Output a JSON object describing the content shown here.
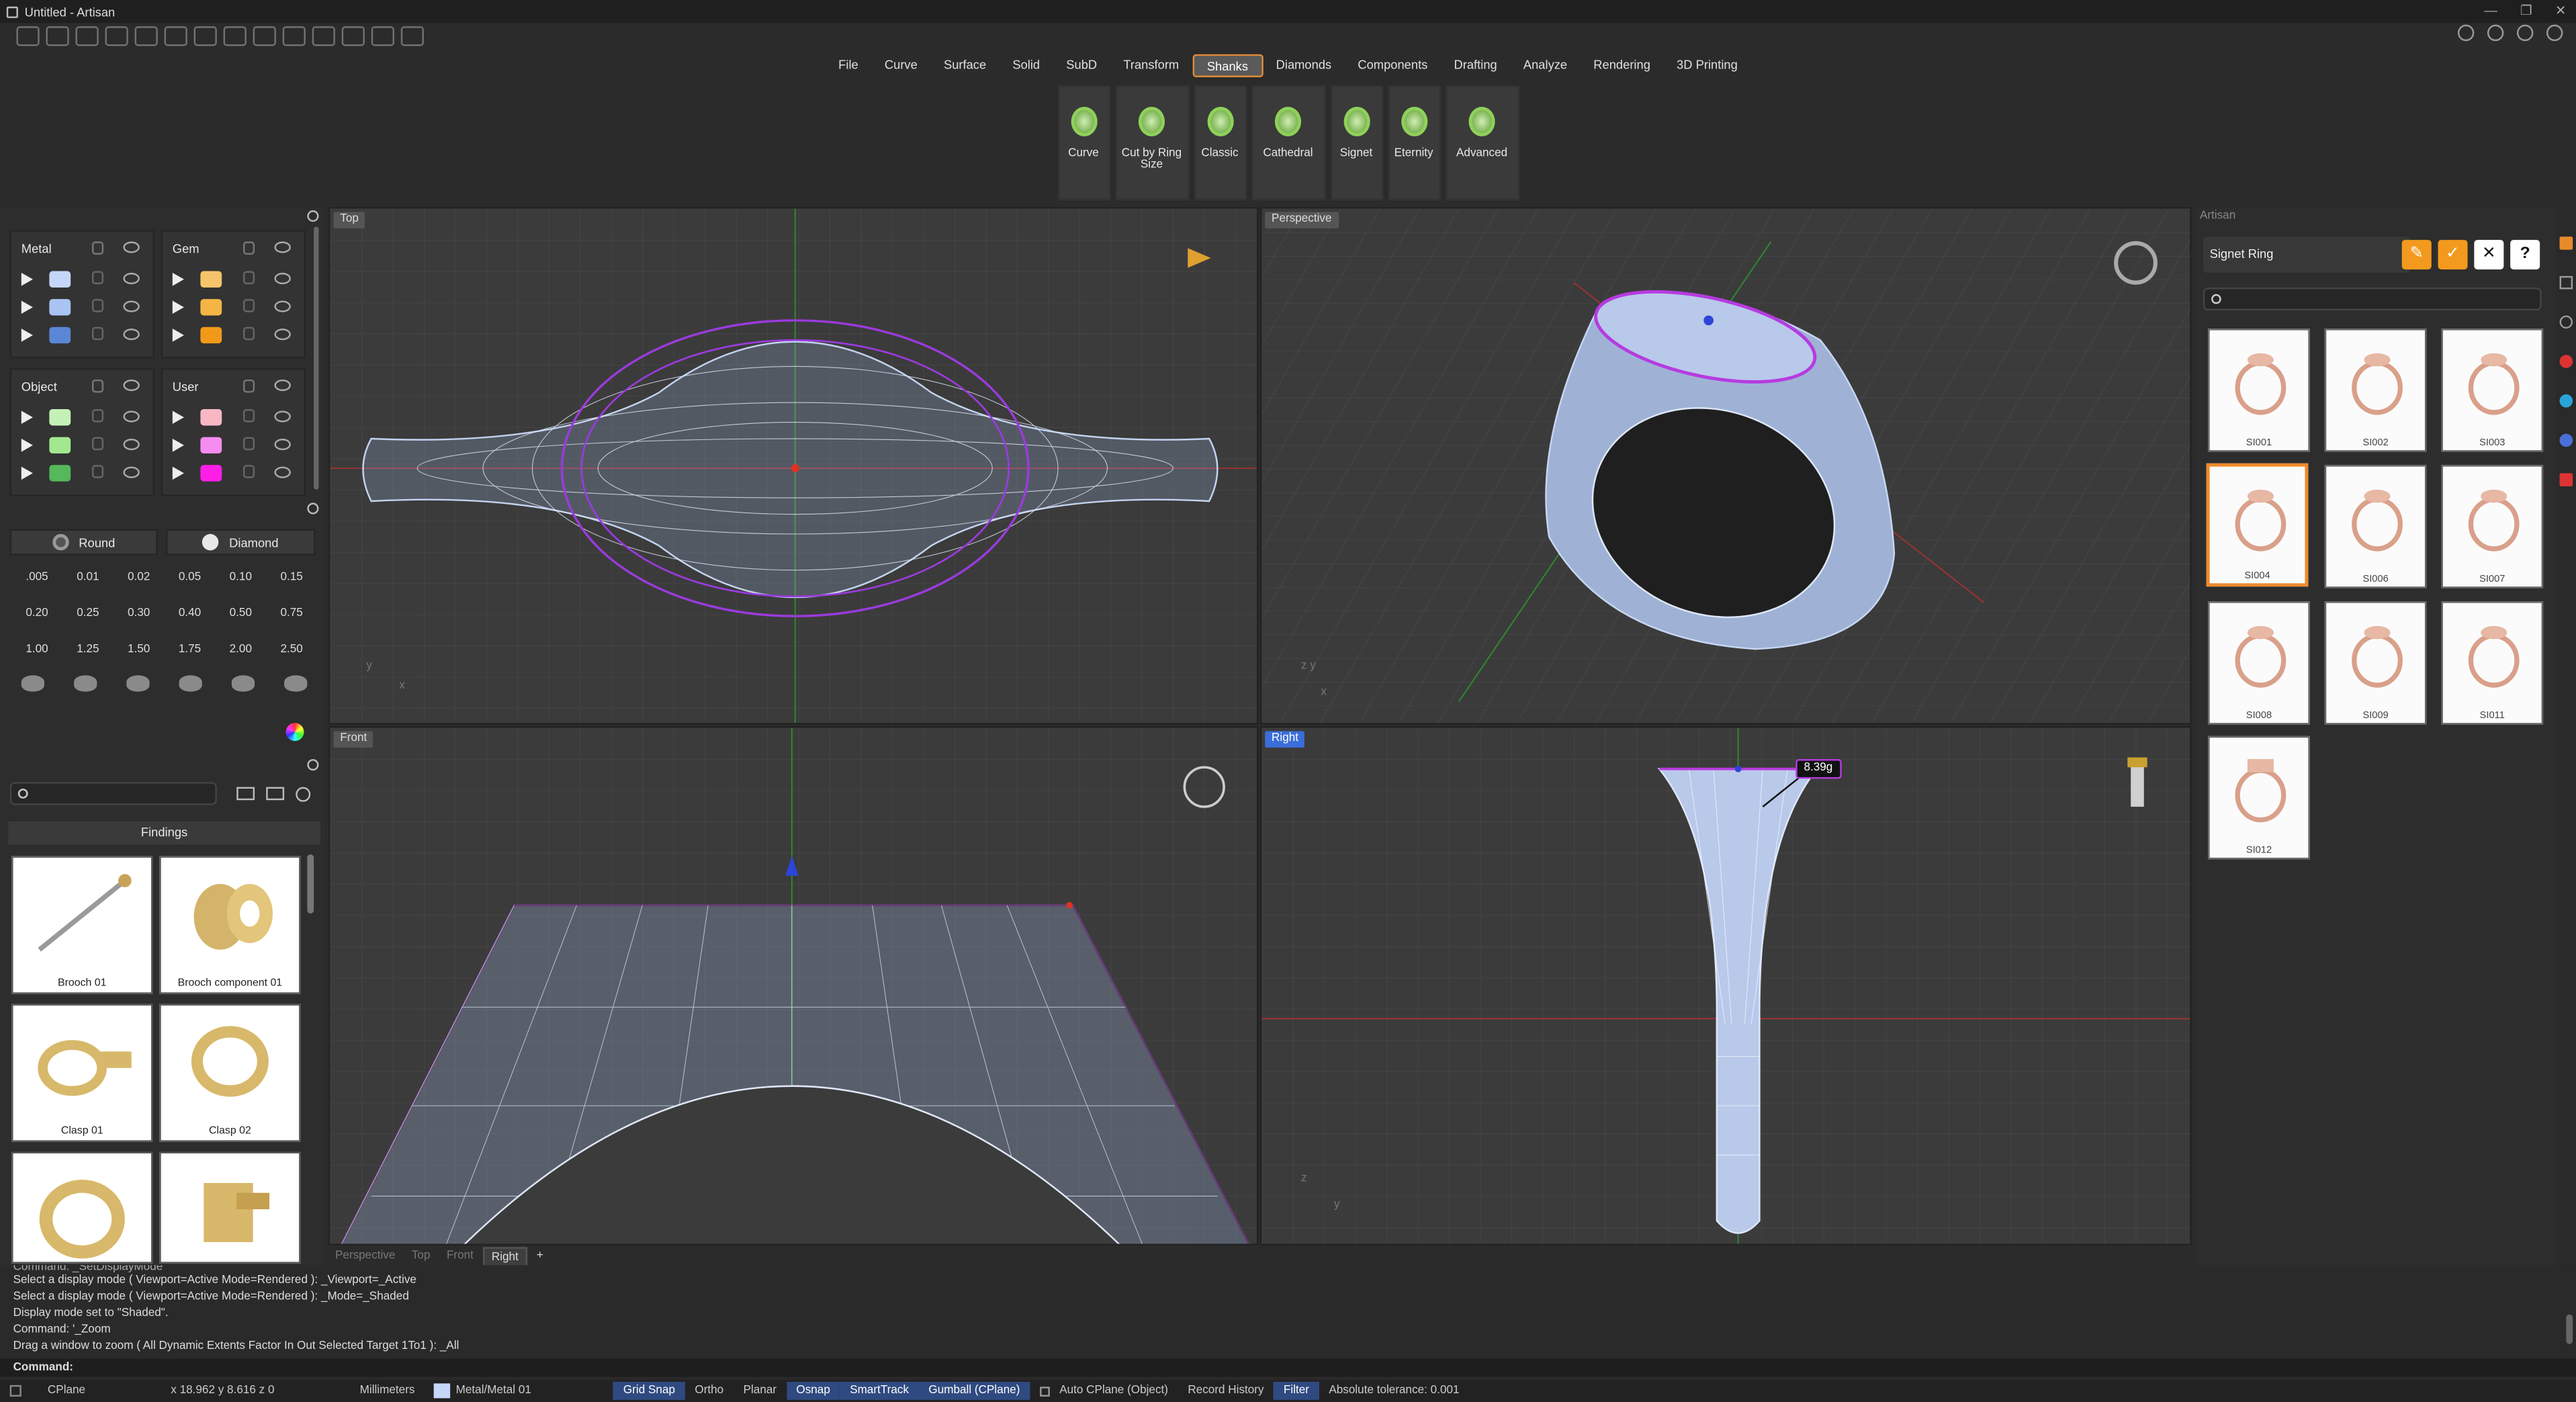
{
  "window": {
    "title": "Untitled - Artisan"
  },
  "menu": [
    "File",
    "Curve",
    "Surface",
    "Solid",
    "SubD",
    "Transform",
    "Shanks",
    "Diamonds",
    "Components",
    "Drafting",
    "Analyze",
    "Rendering",
    "3D Printing"
  ],
  "menu_active": "Shanks",
  "ribbon": [
    {
      "label": "Curve"
    },
    {
      "label": "Cut by Ring Size"
    },
    {
      "label": "Classic"
    },
    {
      "label": "Cathedral"
    },
    {
      "label": "Signet"
    },
    {
      "label": "Eternity"
    },
    {
      "label": "Advanced"
    }
  ],
  "layers": {
    "metal": {
      "title": "Metal",
      "colors": [
        "#c6d6f8",
        "#a9c4f2",
        "#5b86d6"
      ]
    },
    "gem": {
      "title": "Gem",
      "colors": [
        "#f6c46a",
        "#f4b545",
        "#f19a1a"
      ]
    },
    "object": {
      "title": "Object",
      "colors": [
        "#c4f1b8",
        "#a3e88f",
        "#55b85a"
      ]
    },
    "user": {
      "title": "User",
      "colors": [
        "#f7b8c4",
        "#f58cf0",
        "#ff1ee8"
      ]
    }
  },
  "gem_shape": {
    "shape": "Round",
    "type": "Diamond"
  },
  "gem_sizes": [
    ".005",
    "0.01",
    "0.02",
    "0.05",
    "0.10",
    "0.15",
    "0.20",
    "0.25",
    "0.30",
    "0.40",
    "0.50",
    "0.75",
    "1.00",
    "1.25",
    "1.50",
    "1.75",
    "2.00",
    "2.50"
  ],
  "findings": {
    "title": "Findings",
    "items": [
      "Brooch 01",
      "Brooch component 01",
      "Clasp 01",
      "Clasp 02",
      "",
      ""
    ]
  },
  "viewports": {
    "top": "Top",
    "perspective": "Perspective",
    "front": "Front",
    "right": "Right"
  },
  "viewport_tabs": [
    "Perspective",
    "Top",
    "Front",
    "Right"
  ],
  "weight_label": "8.39g",
  "artisan": {
    "panel_title": "Artisan",
    "ring_type": "Signet Ring",
    "items": [
      "SI001",
      "SI002",
      "SI003",
      "SI004",
      "SI006",
      "SI007",
      "SI008",
      "SI009",
      "SI011",
      "SI012"
    ],
    "selected": "SI004"
  },
  "command_history": [
    "Command: _SetDisplayMode",
    "Select a display mode ( Viewport=Active  Mode=Rendered ): _Viewport=_Active",
    "Select a display mode ( Viewport=Active  Mode=Rendered ): _Mode=_Shaded",
    "Display mode set to \"Shaded\".",
    "Command: '_Zoom",
    "Drag a window to zoom ( All  Dynamic  Extents  Factor  In  Out  Selected  Target  1To1 ): _All"
  ],
  "command_prompt": "Command:",
  "status": {
    "cplane": "CPlane",
    "coords": "x 18.962  y 8.616  z 0",
    "units": "Millimeters",
    "layer": "Metal/Metal 01",
    "grid_snap": "Grid Snap",
    "ortho": "Ortho",
    "planar": "Planar",
    "osnap": "Osnap",
    "smarttrack": "SmartTrack",
    "gumball": "Gumball (CPlane)",
    "auto_cplane": "Auto CPlane (Object)",
    "record_history": "Record History",
    "filter": "Filter",
    "tolerance": "Absolute tolerance: 0.001"
  }
}
